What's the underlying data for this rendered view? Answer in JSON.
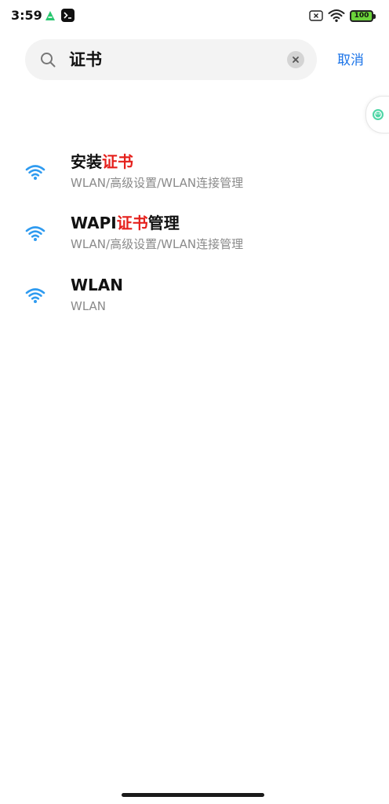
{
  "status_bar": {
    "time": "3:59",
    "battery": "100"
  },
  "search": {
    "query": "证书",
    "cancel_label": "取消"
  },
  "results": [
    {
      "title_pre": "安装",
      "title_match": "证书",
      "title_post": "",
      "path": "WLAN/高级设置/WLAN连接管理",
      "icon": "wifi-icon"
    },
    {
      "title_pre": "WAPI",
      "title_match": "证书",
      "title_post": "管理",
      "path": "WLAN/高级设置/WLAN连接管理",
      "icon": "wifi-icon"
    },
    {
      "title_pre": "WLAN",
      "title_match": "",
      "title_post": "",
      "path": "WLAN",
      "icon": "wifi-icon"
    }
  ],
  "colors": {
    "accent": "#1a73e8",
    "highlight": "#e5211d",
    "wifi_icon": "#2f9bf0"
  }
}
